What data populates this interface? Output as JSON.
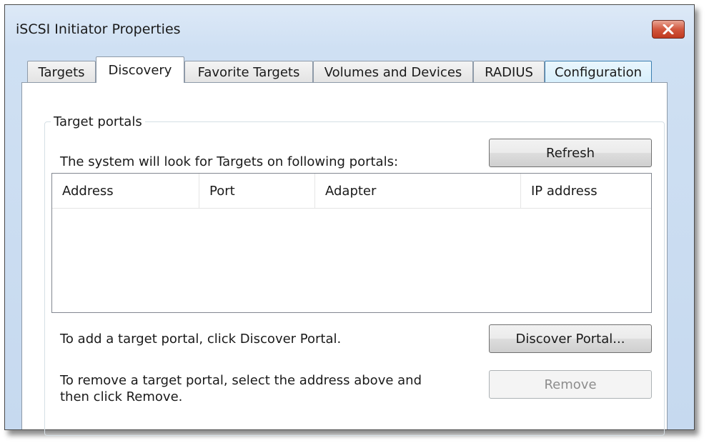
{
  "window": {
    "title": "iSCSI Initiator Properties"
  },
  "tabs": [
    {
      "label": "Targets"
    },
    {
      "label": "Discovery"
    },
    {
      "label": "Favorite Targets"
    },
    {
      "label": "Volumes and Devices"
    },
    {
      "label": "RADIUS"
    },
    {
      "label": "Configuration"
    }
  ],
  "active_tab": "Discovery",
  "target_portals": {
    "legend": "Target portals",
    "description": "The system will look for Targets on following portals:",
    "refresh_label": "Refresh",
    "columns": [
      "Address",
      "Port",
      "Adapter",
      "IP address"
    ],
    "rows": [],
    "add_text": "To add a target portal, click Discover Portal.",
    "discover_label": "Discover Portal...",
    "remove_text_line1": "To remove a target portal, select the address above and",
    "remove_text_line2": "then click Remove.",
    "remove_label": "Remove"
  },
  "colors": {
    "close_button": "#c9452b",
    "hover_tab_border": "#3c7fb1"
  }
}
